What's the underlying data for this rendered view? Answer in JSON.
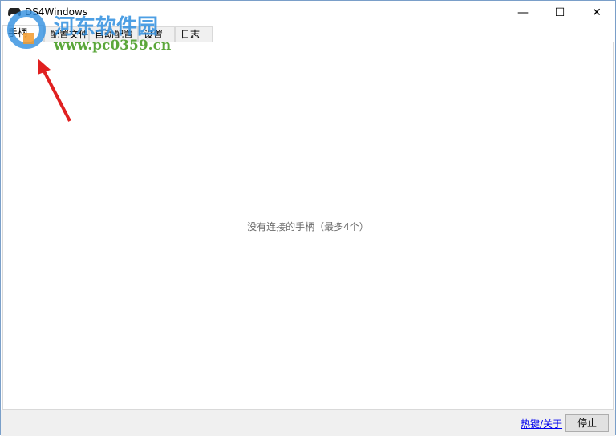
{
  "window": {
    "title": "DS4Windows",
    "minimize": "—",
    "maximize": "☐",
    "close": "✕"
  },
  "tabs": [
    {
      "label": "手柄"
    },
    {
      "label": "配置文件"
    },
    {
      "label": "自动配置"
    },
    {
      "label": "设置"
    },
    {
      "label": "日志"
    }
  ],
  "content": {
    "empty_message": "没有连接的手柄（最多4个）"
  },
  "bottom": {
    "hotkeys_link": "热键/关于",
    "stop_button": "停止"
  },
  "watermark": {
    "name": "河东软件园",
    "url": "www.pc0359.cn"
  }
}
